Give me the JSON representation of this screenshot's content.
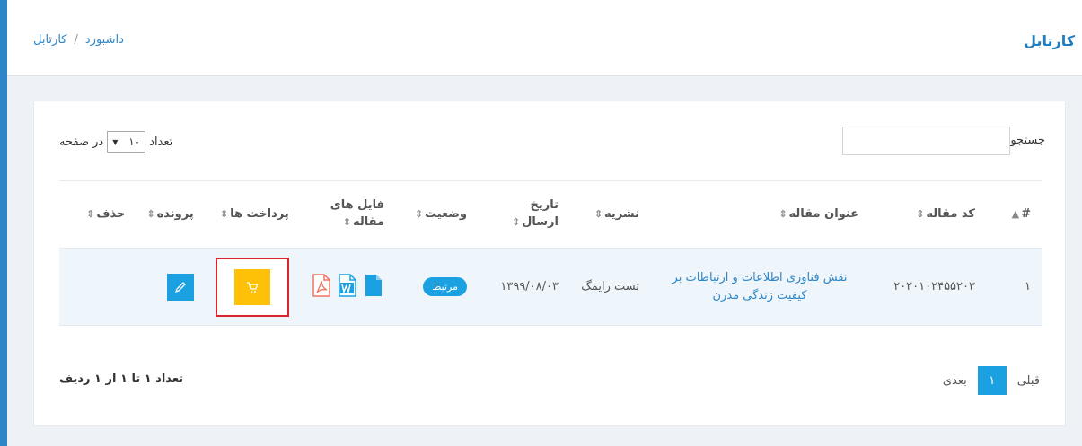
{
  "header": {
    "title": "کارتابل",
    "breadcrumb": [
      "داشبورد",
      "کارتابل"
    ],
    "breadcrumb_sep": "/"
  },
  "controls": {
    "search_label": "جستجو :",
    "search_value": "",
    "length_prefix": "تعداد",
    "length_value": "۱۰",
    "length_suffix": "در صفحه"
  },
  "table": {
    "columns": [
      "#",
      "کد مقاله",
      "عنوان مقاله",
      "نشریه",
      "تاریخ ارسال",
      "وضعیت",
      "فایل های مقاله",
      "پرداخت ها",
      "پرونده",
      "حذف"
    ],
    "rows": [
      {
        "num": "۱",
        "code": "۲۰۲۰۱۰۲۴۵۵۲۰۳",
        "title": "نقش فناوری اطلاعات و ارتباطات بر کیفیت زندگی مدرن",
        "journal": "تست رایمگ",
        "date": "۱۳۹۹/۰۸/۰۳",
        "status": "مرتبط",
        "files": [
          "file-icon",
          "word-icon",
          "pdf-icon"
        ]
      }
    ]
  },
  "footer": {
    "info": "تعداد ۱ تا ۱ از ۱ ردیف",
    "prev": "قبلی",
    "page": "۱",
    "next": "بعدی"
  },
  "colors": {
    "accent": "#1ba1e2",
    "title": "#1f7ec0",
    "pay": "#ffc107",
    "highlight": "#d9232d"
  }
}
